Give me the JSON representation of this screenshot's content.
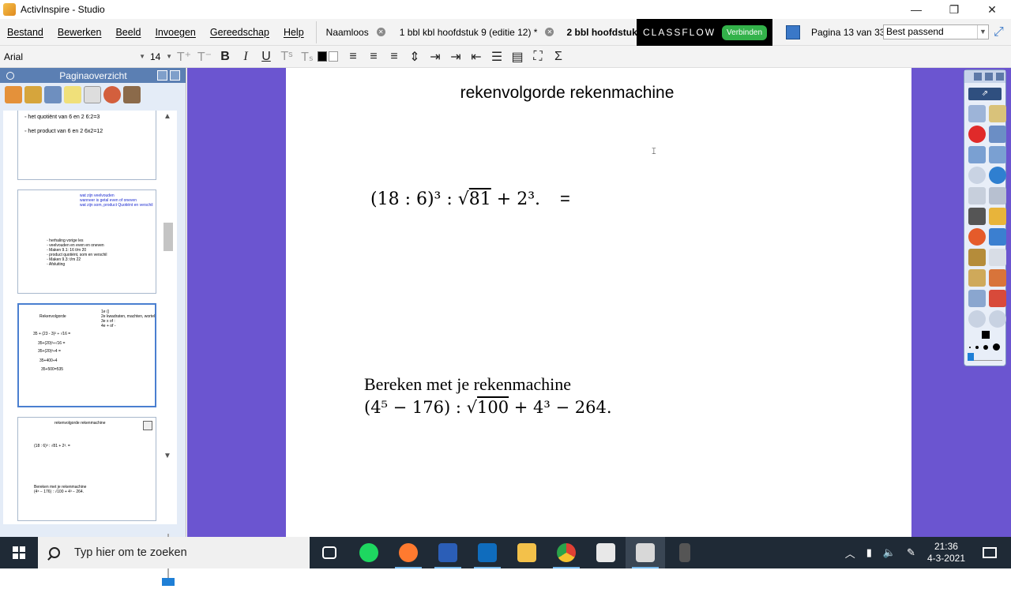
{
  "window": {
    "title": "ActivInspire - Studio",
    "controls": {
      "minimize": "—",
      "maximize": "❐",
      "close": "✕"
    }
  },
  "menu": [
    "Bestand",
    "Bewerken",
    "Beeld",
    "Invoegen",
    "Gereedschap",
    "Help"
  ],
  "doc_tabs": [
    {
      "label": "Naamloos",
      "close": "✕"
    },
    {
      "label": "1 bbl kbl hoofdstuk 9 (editie 12) *",
      "close": "✕"
    },
    {
      "label": "2 bbl hoofdstuk",
      "active": true
    }
  ],
  "classflow": {
    "brand": "CLASSFLOW",
    "button": "Verbinden"
  },
  "page_nav": {
    "label": "Pagina 13 van 33",
    "zoom": "Best passend"
  },
  "format_toolbar": {
    "font": "Arial",
    "size": "14",
    "bold": "B",
    "italic": "I",
    "underline": "U",
    "sigma": "Σ"
  },
  "sorter": {
    "title": "Paginaoverzicht",
    "thumbs": [
      {
        "lines": [
          "◦ het quotiënt van 6 en 2    6:2=3",
          "◦ het product van 6 en 2    6x2=12"
        ]
      },
      {
        "lines": [
          "wat zijn veelvouden",
          "wanneer is getal even of oneven",
          "wat zijn som, product Quotiënt en verschil",
          "◦ herhaling vorige les",
          "◦ veelvouden en even en oneven",
          "◦ Maken 9.1: 16 t/m 20",
          "◦ product quotiënt, som en verschil",
          "◦ Maken 9.3: t/m 22",
          "◦ Afsluiting"
        ]
      },
      {
        "lines": [
          "Rekenvolgorde",
          "1e ()",
          "2e kwadraten, machten, wortel",
          "3e x of :",
          "4e + of -",
          "35 + (23 - 3)² ÷ √16 =",
          "35+(20)²÷√16 =",
          "35+(20)²÷4 =",
          "35+400÷4",
          "35+500=535"
        ]
      },
      {
        "lines": [
          "rekenvolgorde rekenmachine",
          "(18 : 6)³ : √81 + 2³.  =",
          "Bereken met je rekenmachine",
          "(4⁵ − 176) : √100 + 4³ − 264."
        ]
      }
    ]
  },
  "page": {
    "title": "rekenvolgorde rekenmachine",
    "eq1": {
      "base": "(18 : 6)³ : √",
      "radicand": "81",
      "tail": " + 2³.",
      "equals": "="
    },
    "eq2": {
      "heading": "Bereken met je rekenmachine",
      "head": "(4⁵ − 176) : √",
      "radicand": "100",
      "tail": " + 4³ − 264."
    }
  },
  "taskbar": {
    "search_placeholder": "Typ hier om te zoeken",
    "apps": [
      "task-view",
      "spotify",
      "firefox",
      "word",
      "outlook",
      "file-explorer",
      "chrome",
      "store",
      "activinspire",
      "calculator"
    ],
    "clock": {
      "time": "21:36",
      "date": "4-3-2021"
    }
  },
  "colors": {
    "canvas": "#6b55d0",
    "sorter_header": "#5b7fb3",
    "classflow_button": "#33b24a",
    "taskbar": "#1f2a36"
  }
}
